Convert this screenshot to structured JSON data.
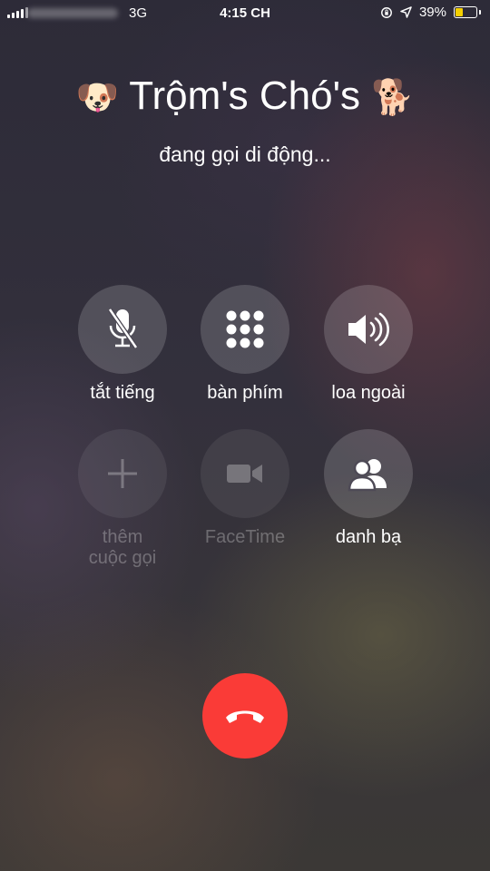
{
  "status_bar": {
    "network": "3G",
    "time": "4:15 CH",
    "battery_percent": "39%",
    "battery_level": 0.39,
    "battery_color": "#f5d000"
  },
  "caller": {
    "leading_emoji": "🐶",
    "name": "Trộm's Chó's",
    "trailing_emoji": "🐕",
    "status": "đang gọi di động..."
  },
  "controls": [
    {
      "label": "tắt tiếng",
      "icon": "mute-microphone-icon",
      "enabled": true
    },
    {
      "label": "bàn phím",
      "icon": "keypad-icon",
      "enabled": true
    },
    {
      "label": "loa ngoài",
      "icon": "speaker-icon",
      "enabled": true
    },
    {
      "label": "thêm\ncuộc gọi",
      "label_line1": "thêm",
      "label_line2": "cuộc gọi",
      "icon": "add-call-icon",
      "enabled": false
    },
    {
      "label": "FaceTime",
      "icon": "facetime-video-icon",
      "enabled": false
    },
    {
      "label": "danh bạ",
      "icon": "contacts-icon",
      "enabled": true
    }
  ],
  "end_call": {
    "icon": "hang-up-icon",
    "color": "#fa3b37"
  }
}
